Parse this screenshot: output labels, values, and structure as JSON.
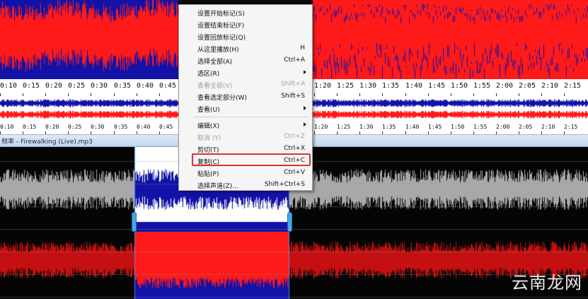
{
  "ruler_top": [
    "0:10",
    "0:15",
    "0:20",
    "0:25",
    "0:30",
    "0:35",
    "0:40",
    "0:45",
    "1:20",
    "1:25",
    "1:30",
    "1:35",
    "1:40",
    "1:45",
    "1:50",
    "1:55",
    "2:00",
    "2:05",
    "2:10",
    "2:15"
  ],
  "ruler_bottom": [
    "0:10",
    "0:15",
    "0:20",
    "0:25",
    "0:30",
    "0:35",
    "0:40",
    "0:45",
    "1:20",
    "1:25",
    "1:30",
    "1:35",
    "1:40",
    "1:45",
    "1:50",
    "1:55",
    "2:00",
    "2:05",
    "2:10",
    "2:15"
  ],
  "window_title": "频率 - Firewalking (Live).mp3",
  "watermark": "云南龙网",
  "colors": {
    "blue": "#1212a8",
    "red": "#ff1a1a",
    "gray": "#a8a8a8",
    "white": "#ffffff",
    "selection_bg": "#ffffff"
  },
  "context_menu": {
    "items": [
      {
        "label": "设置开始标记(S)",
        "shortcut": "",
        "submenu": false,
        "disabled": false
      },
      {
        "label": "设置结束标记(F)",
        "shortcut": "",
        "submenu": false,
        "disabled": false
      },
      {
        "label": "设置回放标记(Q)",
        "shortcut": "",
        "submenu": false,
        "disabled": false
      },
      {
        "label": "从这里播放(H)",
        "shortcut": "H",
        "submenu": false,
        "disabled": false
      },
      {
        "label": "选择全部(A)",
        "shortcut": "Ctrl+A",
        "submenu": false,
        "disabled": false
      },
      {
        "label": "选区(R)",
        "shortcut": "",
        "submenu": true,
        "disabled": false
      },
      {
        "label": "查看全部(V)",
        "shortcut": "Shift+A",
        "submenu": false,
        "disabled": true
      },
      {
        "label": "查看选定部分(W)",
        "shortcut": "Shift+S",
        "submenu": false,
        "disabled": false
      },
      {
        "label": "查看(U)",
        "shortcut": "",
        "submenu": true,
        "disabled": false
      },
      {
        "label": "编辑(X)",
        "shortcut": "",
        "submenu": true,
        "disabled": false
      },
      {
        "label": "取消 (Y)",
        "shortcut": "Ctrl+Z",
        "submenu": false,
        "disabled": true
      },
      {
        "label": "剪切(T)",
        "shortcut": "Ctrl+X",
        "submenu": false,
        "disabled": false
      },
      {
        "label": "复制(C)",
        "shortcut": "Ctrl+C",
        "submenu": false,
        "disabled": false
      },
      {
        "label": "粘贴(P)",
        "shortcut": "Ctrl+V",
        "submenu": false,
        "disabled": false
      },
      {
        "label": "选择声道(Z)...",
        "shortcut": "Shift+Ctrl+S",
        "submenu": false,
        "disabled": false
      }
    ],
    "highlighted": "复制(C)"
  }
}
